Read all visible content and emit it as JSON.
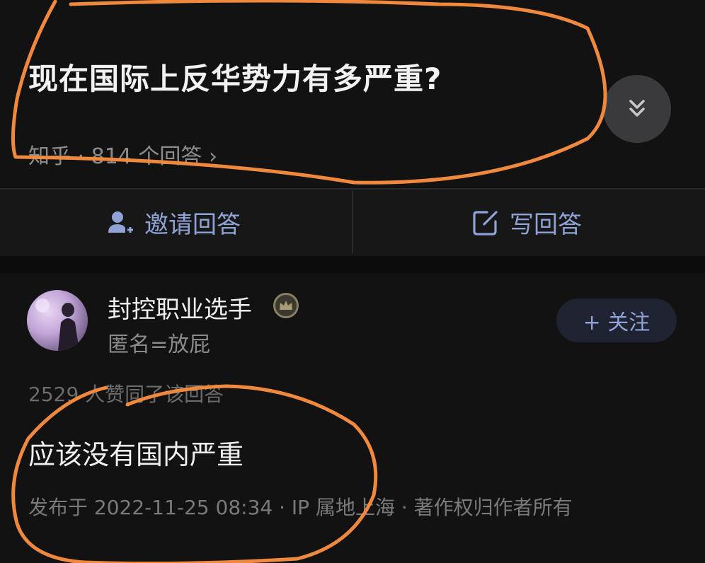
{
  "question": {
    "title": "现在国际上反华势力有多严重?",
    "meta": "知乎 · 814 个回答 ›"
  },
  "actions": {
    "invite_label": "邀请回答",
    "write_label": "写回答"
  },
  "answer": {
    "author_name": "封控职业选手",
    "author_bio": "匿名=放屁",
    "follow_label": "+ 关注",
    "upvote_text": "2529 人赞同了该回答",
    "content": "应该没有国内严重",
    "publish_meta": "发布于 2022-11-25 08:34 · IP 属地上海 · 著作权归作者所有"
  },
  "icons": {
    "collapse": "double-chevron-down-icon",
    "invite": "person-plus-icon",
    "write": "edit-square-icon",
    "badge": "crown-badge-icon"
  },
  "colors": {
    "background": "#121212",
    "accent": "#8fa3d6",
    "annotation": "#f0883e"
  }
}
